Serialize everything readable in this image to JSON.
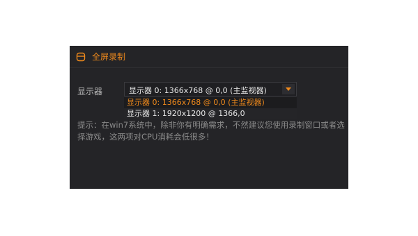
{
  "section": {
    "title": "全屏录制",
    "icon": "window-icon",
    "accent_color": "#f08a1c"
  },
  "display_field": {
    "label": "显示器",
    "selected_value": "显示器 0: 1366x768 @ 0,0 (主监视器)",
    "options": [
      "显示器 0: 1366x768 @ 0,0 (主监视器)",
      "显示器 1: 1920x1200 @ 1366,0"
    ]
  },
  "hint": {
    "text": "提示：在win7系统中，除非你有明确需求，不然建议您使用录制窗口或者选择游戏，这两项对CPU消耗会低很多！"
  }
}
